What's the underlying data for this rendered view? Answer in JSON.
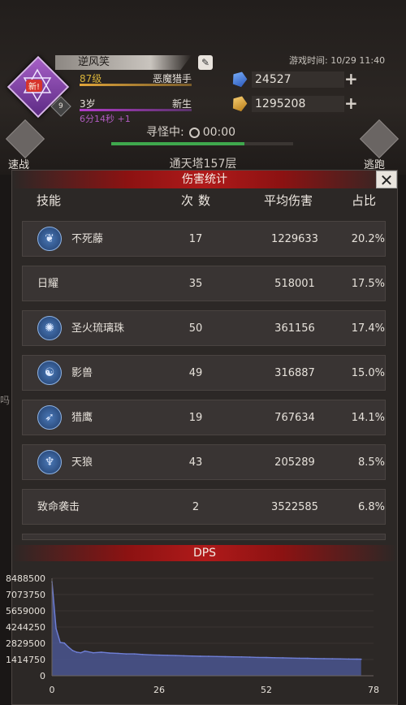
{
  "player": {
    "name": "逆风笑",
    "avatar_badge": "新!",
    "avatar_level": "9",
    "level": "87级",
    "class": "恶魔猎手",
    "age": "3岁",
    "stage": "新生",
    "timer": "6分14秒 +1"
  },
  "game_time": "游戏时间: 10/29 11:40",
  "resources": {
    "gems": "24527",
    "gold": "1295208",
    "add_symbol": "+"
  },
  "search": {
    "label": "寻怪中:",
    "time": "00:00",
    "progress": 0.73
  },
  "side_buttons": {
    "left": "速战",
    "right": "逃跑"
  },
  "tower": "通天塔157层",
  "background_fragment": "吗",
  "panel": {
    "title": "伤害统计",
    "close": "✕",
    "headers": {
      "skill": "技能",
      "count": "次数",
      "avg": "平均伤害",
      "ratio": "占比"
    },
    "rows": [
      {
        "name": "不死藤",
        "count": "17",
        "avg": "1229633",
        "ratio": "20.2%",
        "icon": "vine-icon",
        "glyph": "❦"
      },
      {
        "name": "日耀",
        "count": "35",
        "avg": "518001",
        "ratio": "17.5%",
        "icon": "",
        "glyph": ""
      },
      {
        "name": "圣火琉璃珠",
        "count": "50",
        "avg": "361156",
        "ratio": "17.4%",
        "icon": "orb-icon",
        "glyph": "✺"
      },
      {
        "name": "影兽",
        "count": "49",
        "avg": "316887",
        "ratio": "15.0%",
        "icon": "beast-icon",
        "glyph": "☯"
      },
      {
        "name": "猎鹰",
        "count": "19",
        "avg": "767634",
        "ratio": "14.1%",
        "icon": "falcon-icon",
        "glyph": "➶"
      },
      {
        "name": "天狼",
        "count": "43",
        "avg": "205289",
        "ratio": "8.5%",
        "icon": "wolf-icon",
        "glyph": "♆"
      },
      {
        "name": "致命袭击",
        "count": "2",
        "avg": "3522585",
        "ratio": "6.8%",
        "icon": "",
        "glyph": ""
      }
    ],
    "dps_title": "DPS"
  },
  "colors": {
    "accent_red": "#b01a1a",
    "fill": "#4a5590",
    "line": "#6f7fd6"
  },
  "chart_data": {
    "type": "area",
    "title": "DPS",
    "xlim": [
      0,
      78
    ],
    "ylim": [
      0,
      8488500
    ],
    "x_ticks": [
      0,
      26,
      52,
      78
    ],
    "y_ticks": [
      0,
      1414750,
      2829500,
      4244250,
      5659000,
      7073750,
      8488500
    ],
    "series": [
      {
        "x": [
          0,
          1,
          2,
          3,
          4,
          5,
          6,
          7,
          8,
          10,
          12,
          14,
          16,
          18,
          20,
          22,
          24,
          26,
          28,
          30,
          32,
          34,
          36,
          38,
          40,
          42,
          44,
          46,
          48,
          50,
          52,
          54,
          56,
          58,
          60,
          62,
          64,
          66,
          68,
          70,
          72,
          74,
          75
        ],
        "y": [
          8200000,
          4100000,
          2900000,
          2850000,
          2500000,
          2200000,
          2050000,
          2000000,
          2150000,
          2000000,
          2050000,
          1980000,
          1950000,
          1900000,
          1900000,
          1850000,
          1820000,
          1800000,
          1780000,
          1760000,
          1740000,
          1720000,
          1700000,
          1690000,
          1680000,
          1660000,
          1650000,
          1640000,
          1620000,
          1600000,
          1590000,
          1570000,
          1560000,
          1540000,
          1530000,
          1520000,
          1500000,
          1490000,
          1480000,
          1470000,
          1460000,
          1450000,
          1440000
        ]
      }
    ]
  }
}
